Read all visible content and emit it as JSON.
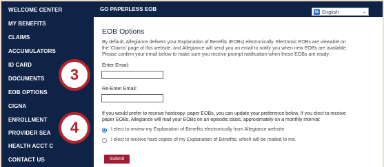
{
  "sidebar": {
    "items": [
      {
        "label": "WELCOME CENTER"
      },
      {
        "label": "MY BENEFITS"
      },
      {
        "label": "CLAIMS"
      },
      {
        "label": "ACCUMULATORS"
      },
      {
        "label": "ID CARD"
      },
      {
        "label": "DOCUMENTS"
      },
      {
        "label": "EOB OPTIONS"
      },
      {
        "label": "CIGNA"
      },
      {
        "label": "ENROLLMENT"
      },
      {
        "label": "PROVIDER SEA"
      },
      {
        "label": "HEALTH ACCT C"
      },
      {
        "label": "CONTACT US"
      }
    ]
  },
  "header": {
    "title": "GO PAPERLESS EOB",
    "language": {
      "selected": "English",
      "icon": "google-translate-icon"
    }
  },
  "main": {
    "section_title": "EOB Options",
    "intro_lines": [
      "By default, Allegiance delivers your Explanation of Benefits (EOBs) electronically. Electronic EOBs are viewable on",
      "the 'Claims' page of this website, and Allegiance will send you an email to notify you when new EOBs are available.",
      "Please confirm your email below to make sure you receive prompt notification when these EOBs are ready."
    ],
    "email_label": "Enter Email:",
    "reenter_label": "Re-Enter Email:",
    "email_value": "",
    "reenter_value": "",
    "paper_lines": [
      "If you would prefer to receive hardcopy, paper EOBs, you can update your preference below. If you elect to receive",
      "paper EOBs, Allegiance will mail your EOBs on an episodic basis, approximately on a monthly interval:"
    ],
    "options": [
      {
        "label": "I elect to review my Explanation of Benefits electronically from Allegiance website",
        "selected": true
      },
      {
        "label": "I elect to receive hard copies of my Explanation of Benefits, which will be mailed to me.",
        "selected": false
      }
    ],
    "submit_label": "Submit"
  },
  "callouts": [
    {
      "number": "3"
    },
    {
      "number": "4"
    }
  ],
  "colors": {
    "navy": "#0f2347",
    "accent_red": "#9e1b32",
    "callout_red": "#b3242c",
    "frame": "#f0dcc8"
  }
}
